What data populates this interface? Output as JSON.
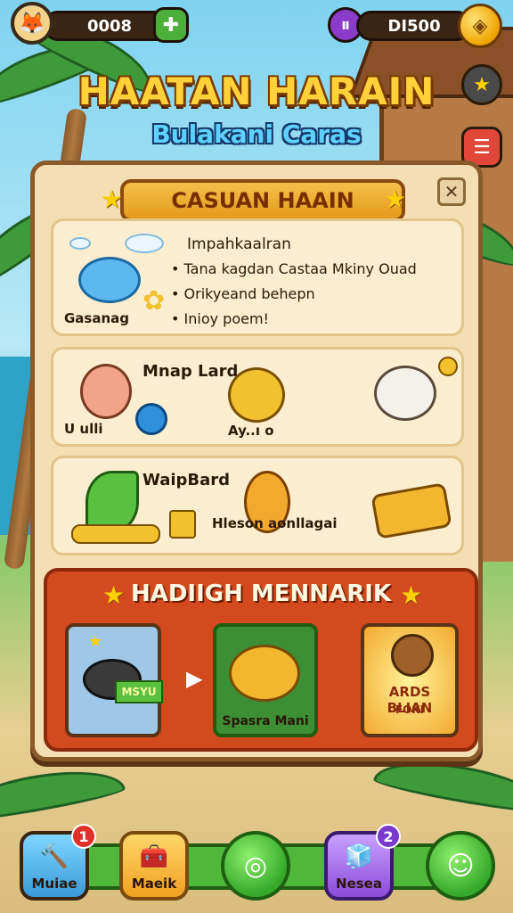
{
  "hud": {
    "left_value": "0008",
    "right_value": "DI500",
    "avatar_icon": "fox-avatar-icon",
    "add_icon": "leaf-plus-icon",
    "pause_icon": "pause-icon",
    "coin_icon": "gold-coin-icon"
  },
  "title": {
    "main": "HAATAN HARAIN",
    "sub": "Bulakani Caras"
  },
  "panel": {
    "header": "CASUAN HAAIN",
    "close_label": "✕",
    "intro": {
      "heading": "Impahkaalran",
      "lines": [
        "• Tana kagdan Castaa Mkiny Ouad",
        "• Orikyeand behepn",
        "• Inioy poem!"
      ],
      "caption": "Gasanag"
    },
    "section2": {
      "heading": "Mnap Lard",
      "label_left": "U ulli",
      "label_mid": "Ay..ı o"
    },
    "section3": {
      "heading": "WaipBard",
      "label": "Hleson aonllagai"
    },
    "reward": {
      "title": "HADIIGH MENNARIK",
      "tile1_tag": "MSYU",
      "tile2_label": "Spasra Mani",
      "tile3_title": "ARDS BLIAN",
      "tile3_sub": "FOKI"
    }
  },
  "nav": {
    "items": [
      {
        "label": "Muiae",
        "badge": "1",
        "icon": "hammer-icon"
      },
      {
        "label": "Maeik",
        "badge": "",
        "icon": "treasure-chest-icon"
      },
      {
        "label": "",
        "badge": "",
        "icon": "chat-bubble-icon"
      },
      {
        "label": "Nesea",
        "badge": "2",
        "icon": "cup-icon"
      },
      {
        "label": "",
        "badge": "",
        "icon": "message-icon"
      }
    ]
  },
  "colors": {
    "accent_gold": "#ffd23a",
    "panel_bg": "#f3dfb3",
    "reward_red": "#d24a1e",
    "nav_green": "#35a92a"
  }
}
